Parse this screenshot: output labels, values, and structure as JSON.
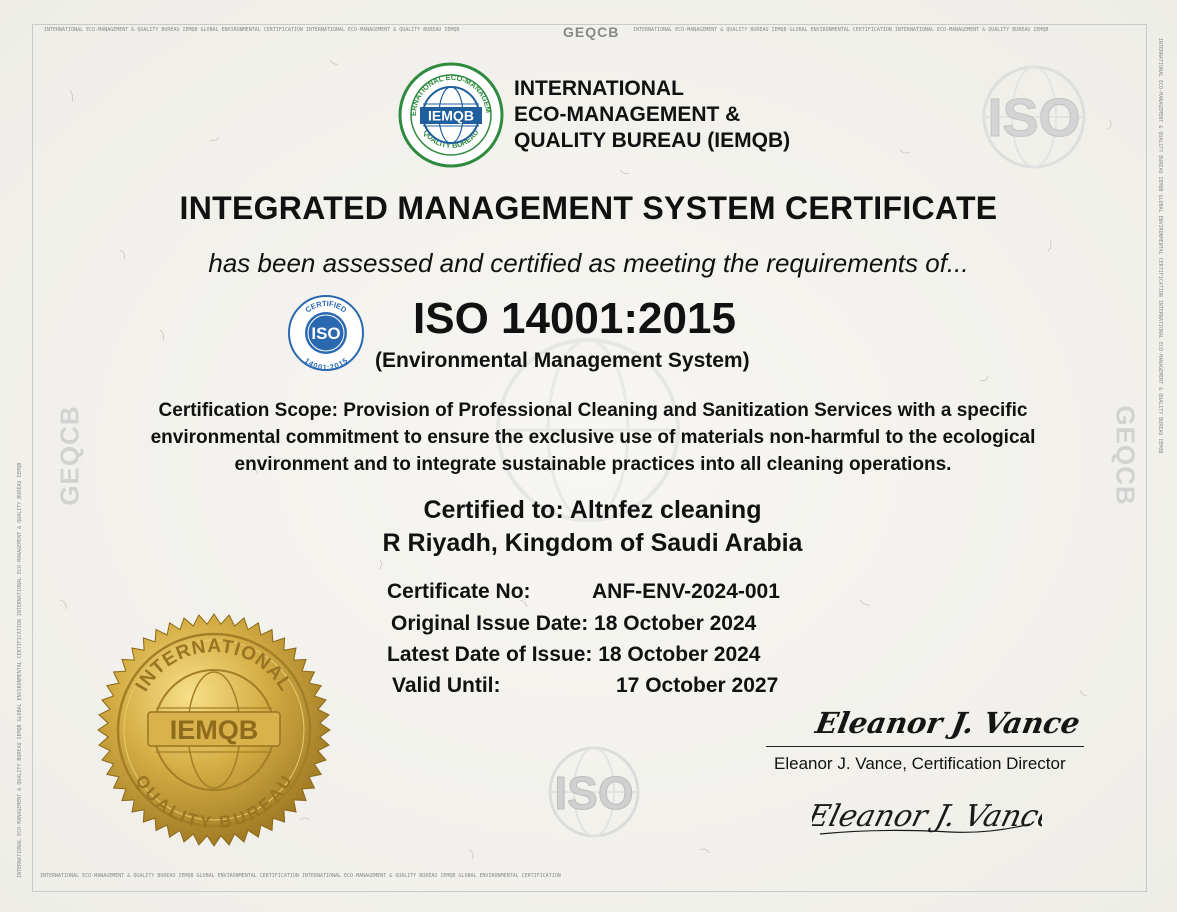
{
  "microtext": {
    "top_left": "INTERNATIONAL ECO-MANAGEMENT & QUALITY BUREAU IEMQB GLOBAL ENVIRONMENTAL CERTIFICATION INTERNATIONAL ECO-MANAGEMENT & QUALITY BUREAU IEMQB",
    "top_right": "INTERNATIONAL ECO-MANAGEMENT & QUALITY BUREAU IEMQB GLOBAL ENVIRONMENTAL CERTIFICATION INTERNATIONAL ECO-MANAGEMENT & QUALITY BUREAU IEMQB",
    "bottom": "INTERNATIONAL ECO-MANAGEMENT & QUALITY BUREAU IEMQB GLOBAL ENVIRONMENTAL CERTIFICATION INTERNATIONAL ECO-MANAGEMENT & QUALITY BUREAU IEMQB GLOBAL ENVIRONMENTAL CERTIFICATION",
    "side": "INTERNATIONAL ECO-MANAGEMENT & QUALITY BUREAU IEMQB GLOBAL ENVIRONMENTAL CERTIFICATION INTERNATIONAL ECO-MANAGEMENT & QUALITY BUREAU IEMQB"
  },
  "watermark": {
    "geqcb": "GEQCB",
    "iso": "ISO"
  },
  "issuer": {
    "logo_text": "IEMQB",
    "logo_ring_top": "INTERNATIONAL ECO-MANAGEMENT",
    "logo_ring_bottom": "QUALITY BUREAU",
    "name_line1": "INTERNATIONAL",
    "name_line2": "ECO-MANAGEMENT &",
    "name_line3": "QUALITY BUREAU (IEMQB)"
  },
  "certificate": {
    "title": "INTEGRATED MANAGEMENT SYSTEM CERTIFICATE",
    "subtitle": "has been assessed and certified as meeting the requirements of...",
    "badge_top": "CERTIFIED",
    "badge_center": "ISO",
    "badge_bottom": "14001:2015",
    "standard": "ISO 14001:2015",
    "standard_desc": "(Environmental Management System)",
    "scope_line1": "Certification Scope: Provision of Professional Cleaning and Sanitization Services with a specific",
    "scope_line2": "environmental commitment to ensure the exclusive use of materials non-harmful to the ecological",
    "scope_line3": "environment and to integrate sustainable practices into all cleaning operations.",
    "certified_to": "Certified to: Altnfez cleaning",
    "location": "R Riyadh, Kingdom of Saudi Arabia"
  },
  "details": {
    "cert_no_label": "Certificate No:",
    "cert_no_value": "ANF-ENV-2024-001",
    "original_issue": "Original Issue Date: 18 October 2024",
    "latest_issue": "Latest Date of Issue: 18 October 2024",
    "valid_label": "Valid Until:",
    "valid_value": "17 October 2027"
  },
  "seal": {
    "center": "IEMQB",
    "ring_top": "INTERNATIONAL",
    "ring_bottom": "QUALITY BUREAU"
  },
  "signature": {
    "signed_name": "Eleanor J. Vance",
    "caption": "Eleanor J. Vance, Certification Director",
    "handwritten": "Eleanor J. Vance"
  },
  "colors": {
    "logo_green": "#2e8b3e",
    "logo_blue": "#1f5f9e",
    "iso_blue": "#2a68b0",
    "gold": "#c9a23a"
  }
}
